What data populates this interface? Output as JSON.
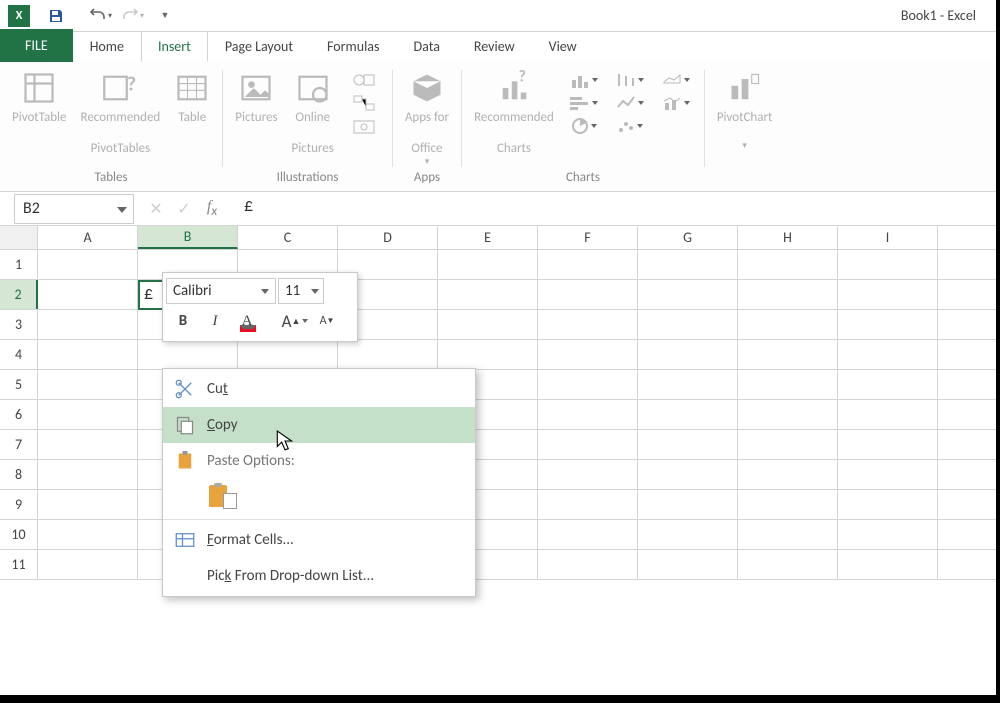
{
  "titlebar": {
    "doc_title": "Book1 - Excel"
  },
  "tabs": {
    "file": "FILE",
    "home": "Home",
    "insert": "Insert",
    "page_layout": "Page Layout",
    "formulas": "Formulas",
    "data": "Data",
    "review": "Review",
    "view": "View",
    "active": "Insert"
  },
  "ribbon": {
    "tables": {
      "label": "Tables",
      "pivottable": "PivotTable",
      "recommended_pt_l1": "Recommended",
      "recommended_pt_l2": "PivotTables",
      "table": "Table"
    },
    "illustrations": {
      "label": "Illustrations",
      "pictures": "Pictures",
      "online_l1": "Online",
      "online_l2": "Pictures"
    },
    "apps": {
      "label": "Apps",
      "apps_for_l1": "Apps for",
      "apps_for_l2": "Office"
    },
    "charts": {
      "label": "Charts",
      "recommended_l1": "Recommended",
      "recommended_l2": "Charts",
      "pivotchart": "PivotChart"
    }
  },
  "namebox": "B2",
  "formula": "£",
  "active_cell": {
    "ref": "B2",
    "value": "£",
    "col": "B",
    "row": "2"
  },
  "columns": [
    "A",
    "B",
    "C",
    "D",
    "E",
    "F",
    "G",
    "H",
    "I"
  ],
  "rows": [
    "1",
    "2",
    "3",
    "4",
    "5",
    "6",
    "7",
    "8",
    "9",
    "10",
    "11"
  ],
  "mini_toolbar": {
    "font": "Calibri",
    "size": "11"
  },
  "context_menu": {
    "cut": {
      "label": "Cut",
      "accel": "t"
    },
    "copy": {
      "label": "Copy",
      "accel": "C"
    },
    "paste_options": "Paste Options:",
    "format_cells": {
      "label": "Format Cells...",
      "accel": "F"
    },
    "pick_list": {
      "label": "Pick From Drop-down List...",
      "accel": "K"
    }
  }
}
